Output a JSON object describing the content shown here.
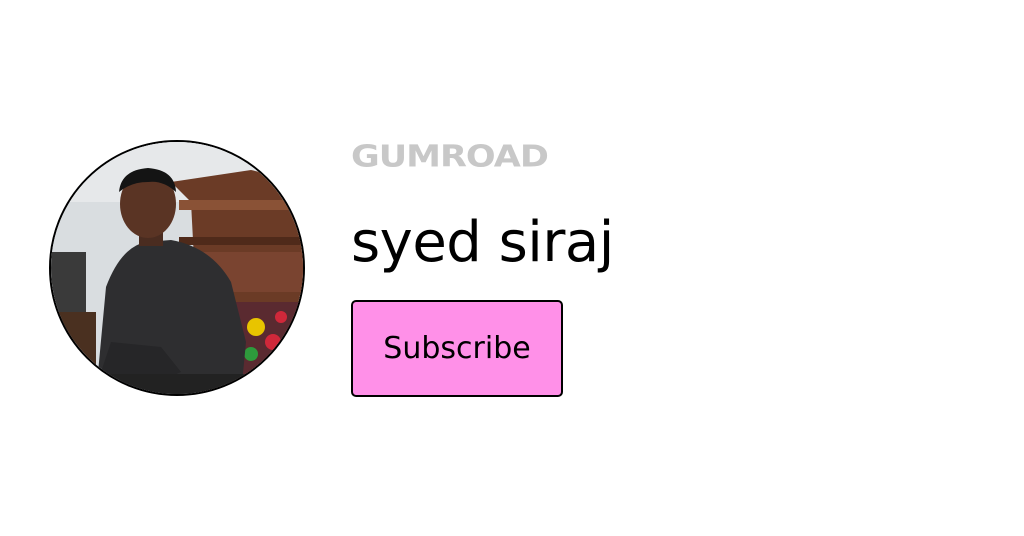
{
  "brand": {
    "logo_text": "gumroad",
    "logo_color": "#c8c8c8"
  },
  "profile": {
    "name": "syed siraj",
    "avatar_icon": "profile-photo"
  },
  "actions": {
    "subscribe_label": "Subscribe",
    "subscribe_color": "#ff90e8"
  }
}
